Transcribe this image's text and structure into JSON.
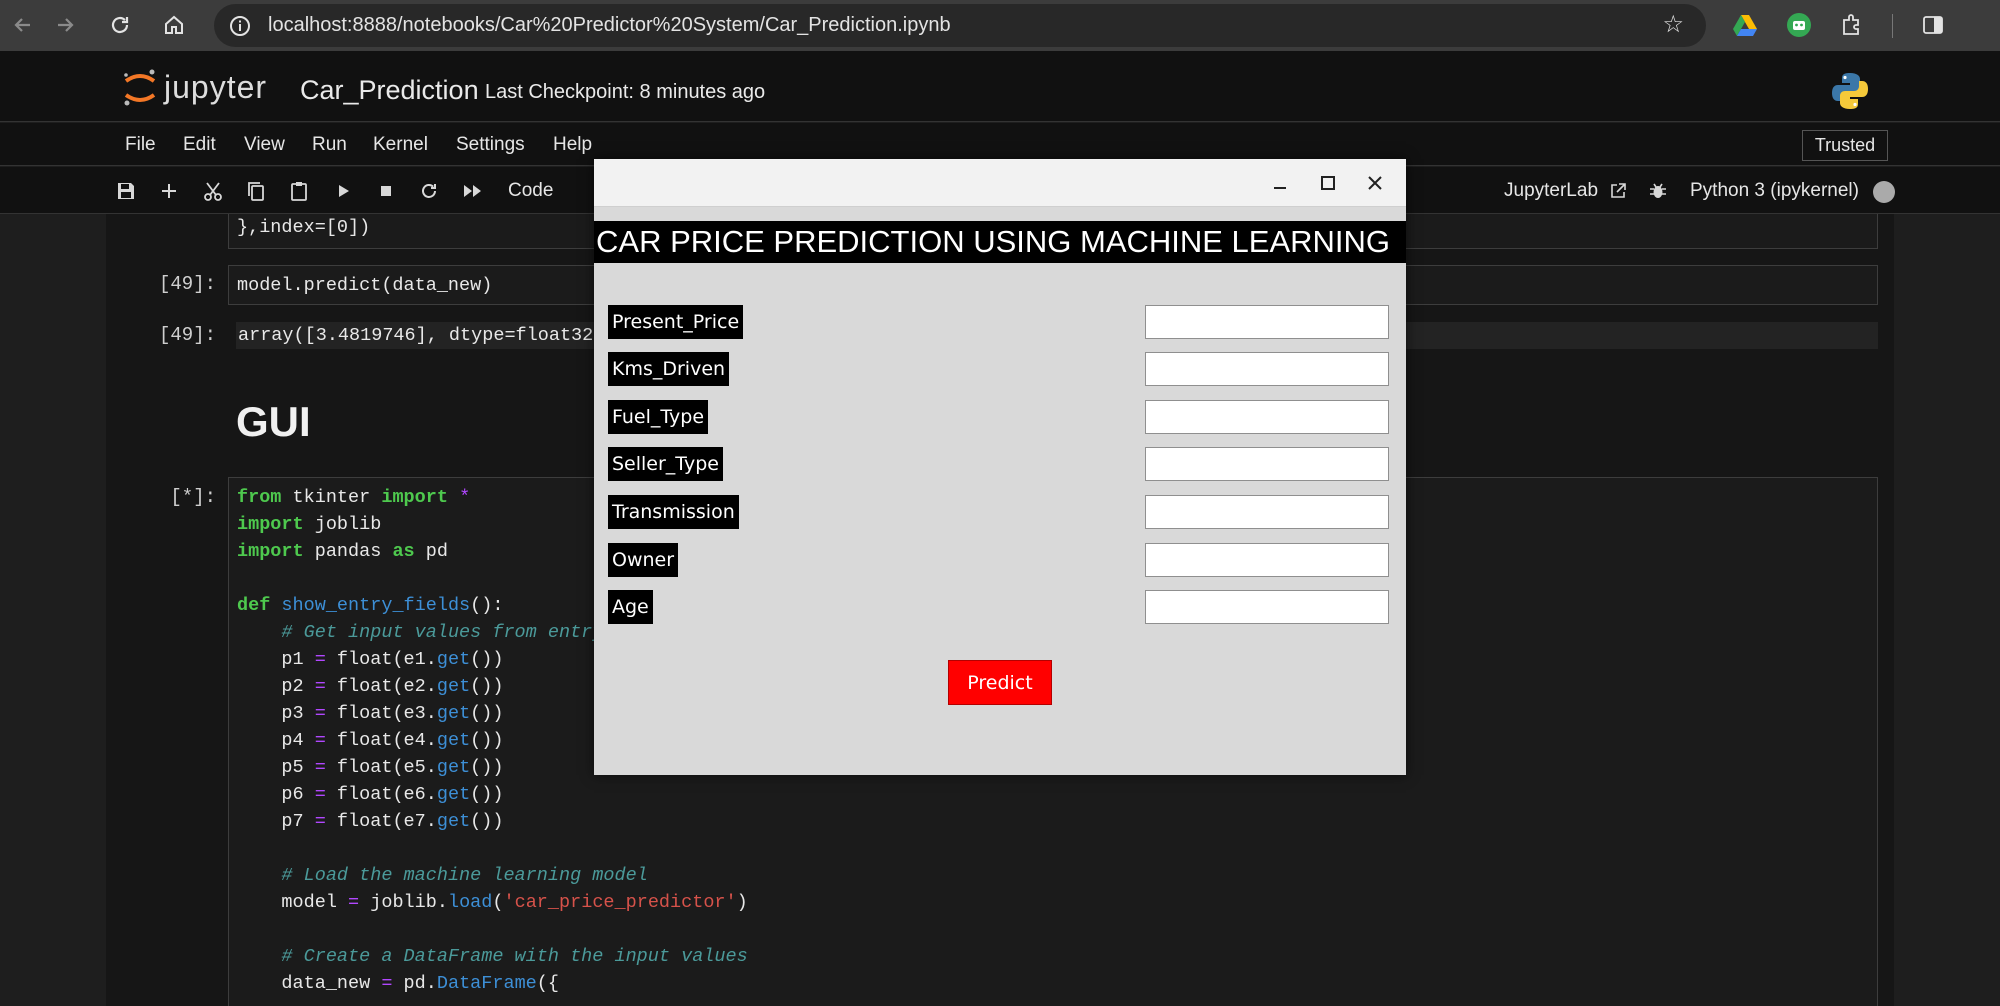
{
  "browser": {
    "url": "localhost:8888/notebooks/Car%20Predictor%20System/Car_Prediction.ipynb"
  },
  "jupyter": {
    "logo_text": "jupyter",
    "notebook_title": "Car_Prediction",
    "checkpoint": "Last Checkpoint: 8 minutes ago",
    "menu": [
      "File",
      "Edit",
      "View",
      "Run",
      "Kernel",
      "Settings",
      "Help"
    ],
    "trusted": "Trusted",
    "cell_type": "Code",
    "jupyterlab_link": "JupyterLab",
    "kernel_name": "Python 3 (ipykernel)"
  },
  "cells": {
    "cell0_tail": "},index=[0])",
    "cell49_prompt": "[49]:",
    "cell49_code": "model.predict(data_new)",
    "out49_prompt": "[49]:",
    "out49_text": "array([3.4819746], dtype=float32)",
    "heading": "GUI",
    "cell_star_prompt": "[*]:"
  },
  "tk": {
    "heading": "CAR PRICE PREDICTION USING MACHINE LEARNING",
    "labels": [
      "Present_Price",
      "Kms_Driven",
      "Fuel_Type",
      "Seller_Type",
      "Transmission",
      "Owner",
      "Age"
    ],
    "entries": [
      "",
      "",
      "",
      "",
      "",
      "",
      ""
    ],
    "button": "Predict"
  }
}
